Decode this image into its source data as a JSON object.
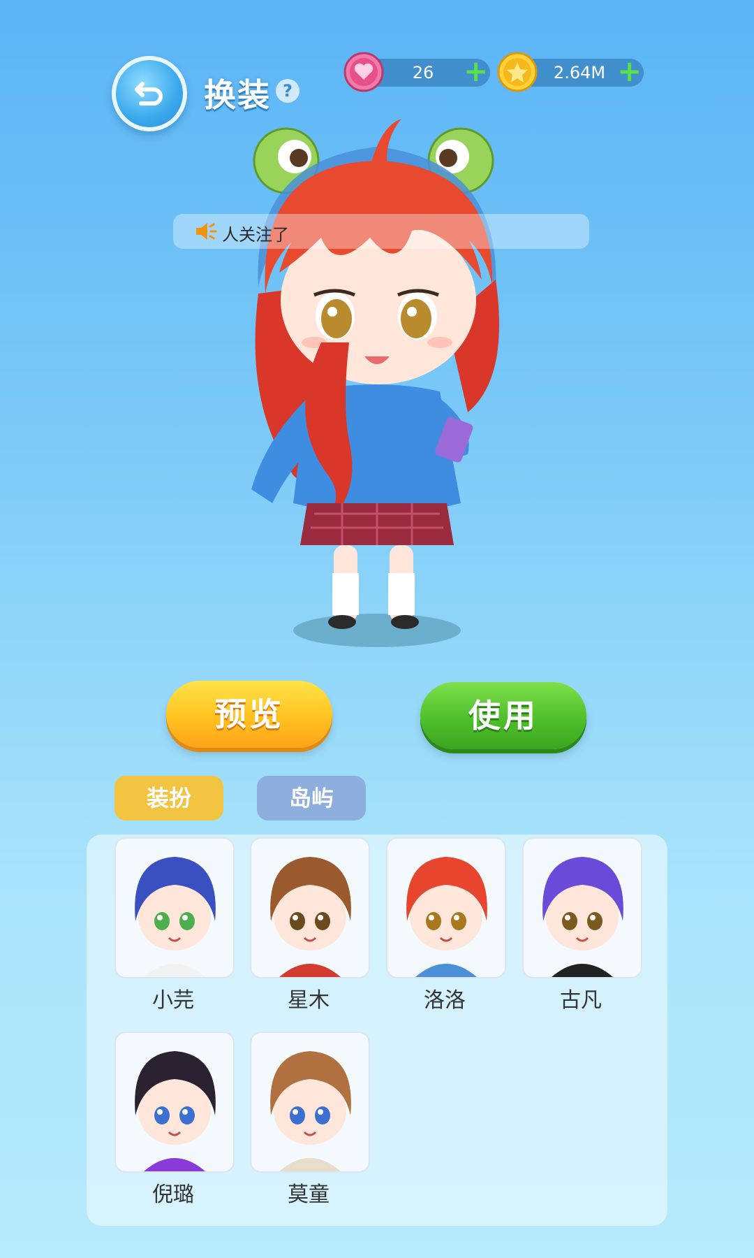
{
  "header": {
    "title": "换装",
    "help": "?",
    "back_icon": "back-arrow-icon"
  },
  "currency": {
    "hearts": {
      "value": "26",
      "icon": "heart-icon",
      "color": "#e8508a"
    },
    "coins": {
      "value": "2.64M",
      "icon": "star-coin-icon",
      "color": "#f6c21a"
    },
    "plus": "+"
  },
  "notice": {
    "icon": "speaker-icon",
    "text": "人关注了"
  },
  "actions": {
    "preview": "预览",
    "use": "使用"
  },
  "tabs": [
    {
      "label": "装扮",
      "active": true
    },
    {
      "label": "岛屿",
      "active": false
    }
  ],
  "characters": [
    {
      "name": "小芫",
      "hair": "#3a4fc0",
      "shirt": "#f2f2f2",
      "eyes": "#4cae4c"
    },
    {
      "name": "星木",
      "hair": "#9b5a2e",
      "shirt": "#d33b30",
      "eyes": "#6b4a1e"
    },
    {
      "name": "洛洛",
      "hair": "#e8452e",
      "shirt": "#4a8fd8",
      "eyes": "#a8781e"
    },
    {
      "name": "古凡",
      "hair": "#6a4ad8",
      "shirt": "#222222",
      "eyes": "#7a5a1e"
    },
    {
      "name": "倪璐",
      "hair": "#2a2230",
      "shirt": "#8a3ad8",
      "eyes": "#3b6fd0"
    },
    {
      "name": "莫童",
      "hair": "#b07040",
      "shirt": "#e8dccb",
      "eyes": "#3b6fd0"
    }
  ]
}
